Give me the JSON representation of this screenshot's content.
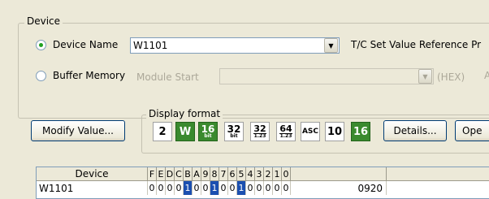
{
  "device_group": {
    "title": "Device",
    "device_name_label": "Device Name",
    "device_name_mnemonic": "N",
    "device_name_value": "W1101",
    "tc_label": "T/C Set Value Reference Pr",
    "buffer_memory_label": "Buffer Memory",
    "buffer_memory_mnemonic": "M",
    "module_start_label": "Module Start",
    "hex_label": "(HEX)",
    "selected": "device_name"
  },
  "modify_button": "Modify Value...",
  "display_format": {
    "title": "Display format",
    "buttons": [
      {
        "id": "fmt-2",
        "label": "2",
        "on": false
      },
      {
        "id": "fmt-w",
        "label": "W",
        "on": true
      },
      {
        "id": "fmt-16bit",
        "label": "16",
        "sub": "bit",
        "on": true
      },
      {
        "id": "fmt-32bit",
        "label": "32",
        "sub": "bit",
        "on": false
      },
      {
        "id": "fmt-32-123",
        "label": "32",
        "sub": "1.23",
        "on": false
      },
      {
        "id": "fmt-64-123",
        "label": "64",
        "sub": "1.23",
        "on": false
      },
      {
        "id": "fmt-asc",
        "label": "ASC",
        "on": false
      },
      {
        "id": "fmt-10",
        "label": "10",
        "on": false
      },
      {
        "id": "fmt-16",
        "label": "16",
        "on": true
      }
    ]
  },
  "details_button": "Details...",
  "open_button": "Ope",
  "table": {
    "headers": {
      "device": "Device",
      "bits": [
        "F",
        "E",
        "D",
        "C",
        "B",
        "A",
        "9",
        "8",
        "7",
        "6",
        "5",
        "4",
        "3",
        "2",
        "1",
        "0"
      ]
    },
    "rows": [
      {
        "device": "W1101",
        "bits": [
          "0",
          "0",
          "0",
          "0",
          "1",
          "0",
          "0",
          "1",
          "0",
          "0",
          "1",
          "0",
          "0",
          "0",
          "0",
          "0"
        ],
        "value": "0920"
      }
    ]
  },
  "colors": {
    "accent_green": "#3a8a2e",
    "bit_highlight": "#1b4fb0"
  }
}
